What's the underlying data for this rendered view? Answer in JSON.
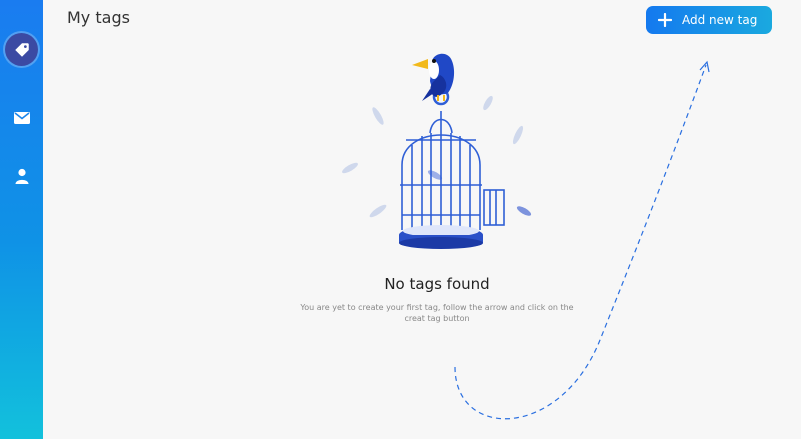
{
  "page": {
    "title": "My tags"
  },
  "header": {
    "add_button_label": "Add new tag"
  },
  "sidebar": {
    "items": [
      {
        "name": "tags",
        "icon": "tag-icon",
        "active": true
      },
      {
        "name": "messages",
        "icon": "mail-icon",
        "active": false
      },
      {
        "name": "profile",
        "icon": "user-icon",
        "active": false
      }
    ]
  },
  "empty_state": {
    "title": "No tags found",
    "description": "You are yet to create your first tag, follow the arrow and click on the creat tag button"
  },
  "colors": {
    "sidebar_top": "#1a7cf0",
    "sidebar_bottom": "#12c1dc",
    "active_circle": "#3b4aa3",
    "accent": "#1479ef",
    "cage": "#2f5fd6"
  }
}
